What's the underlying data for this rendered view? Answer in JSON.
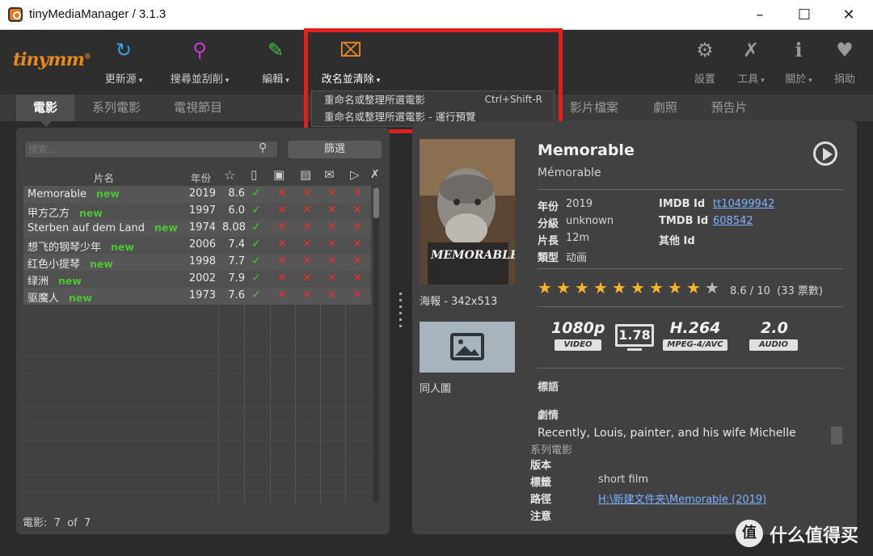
{
  "window": {
    "title": "tinyMediaManager / 3.1.3",
    "min": "–",
    "max": "☐",
    "close": "✕"
  },
  "toolbar": {
    "logo": "tinymm",
    "logo_mark": "®",
    "items": [
      {
        "label": "更新源",
        "icon": "refresh-icon",
        "glyph": "↻",
        "color": "#3aa0e8"
      },
      {
        "label": "搜尋並刮削",
        "icon": "search-icon",
        "glyph": "⚲",
        "color": "#c83bd6"
      },
      {
        "label": "編輯",
        "icon": "edit-icon",
        "glyph": "✎",
        "color": "#3ec24a"
      },
      {
        "label": "改名並清除",
        "icon": "rename-icon",
        "glyph": "⌧",
        "color": "#f08a24"
      }
    ],
    "right_items": [
      {
        "label": "設置",
        "icon": "gear-icon",
        "glyph": "⚙"
      },
      {
        "label": "工具",
        "icon": "tools-icon",
        "glyph": "✗"
      },
      {
        "label": "關於",
        "icon": "info-icon",
        "glyph": "ℹ"
      },
      {
        "label": "捐助",
        "icon": "heart-icon",
        "glyph": "♥"
      }
    ],
    "caret": "▾"
  },
  "dropdown": {
    "items": [
      {
        "label": "重命名或整理所選電影",
        "shortcut": "Ctrl+Shift-R"
      },
      {
        "label": "重命名或整理所選電影 - 運行預覽",
        "shortcut": ""
      }
    ]
  },
  "tabs": [
    "電影",
    "系列電影",
    "電視節目",
    "影片檔案",
    "劇照",
    "預告片"
  ],
  "left": {
    "search_placeholder": "搜索...",
    "filter_label": "篩選",
    "col_name": "片名",
    "col_year": "年份",
    "new_tag": "new",
    "ok": "✓",
    "no": "✕",
    "movies": [
      {
        "name": "Memorable",
        "year": "2019",
        "rating": "8.6"
      },
      {
        "name": "甲方乙方",
        "year": "1997",
        "rating": "6.0"
      },
      {
        "name": "Sterben auf dem Land",
        "year": "1974",
        "rating": "8.08"
      },
      {
        "name": "想飞的钢琴少年",
        "year": "2006",
        "rating": "7.4"
      },
      {
        "name": "红色小提琴",
        "year": "1998",
        "rating": "7.7"
      },
      {
        "name": "绿洲",
        "year": "2002",
        "rating": "7.9"
      },
      {
        "name": "驱魔人",
        "year": "1973",
        "rating": "7.6"
      }
    ],
    "count_label": "電影:",
    "count_value": "7",
    "count_of": "of",
    "count_total": "7"
  },
  "detail": {
    "title": "Memorable",
    "original_title": "Mémorable",
    "poster_text": "MEMORABLE",
    "poster_label": "海報 - 342x513",
    "fanart_label": "同人圖",
    "year_label": "年份",
    "year": "2019",
    "cert_label": "分級",
    "cert": "unknown",
    "runtime_label": "片長",
    "runtime": "12m",
    "genre_label": "類型",
    "genre": "动画",
    "imdb_label": "IMDB Id",
    "imdb": "tt10499942",
    "tmdb_label": "TMDB Id",
    "tmdb": "608542",
    "other_label": "其他 Id",
    "rating_value": 8.6,
    "rating_max": 10,
    "rating_text": "8.6 / 10",
    "votes_text": "(33 票數)",
    "media": {
      "resolution": "1080p",
      "resolution_tag": "VIDEO",
      "aspect": "1.78",
      "codec": "H.264",
      "codec_tag": "MPEG-4/AVC",
      "audio": "2.0",
      "audio_tag": "AUDIO"
    },
    "tagline_label": "標語",
    "plot_label": "劇情",
    "plot": "Recently, Louis, painter, and his wife Michelle",
    "plot_overflow": "系列電影",
    "version_label": "版本",
    "tags_label": "標籤",
    "tags": "short film",
    "path_label": "路徑",
    "path": "H:\\新建文件夹\\Memorable (2019)",
    "note_label": "注意"
  },
  "watermark": {
    "mark": "值",
    "text": "什么值得买"
  }
}
